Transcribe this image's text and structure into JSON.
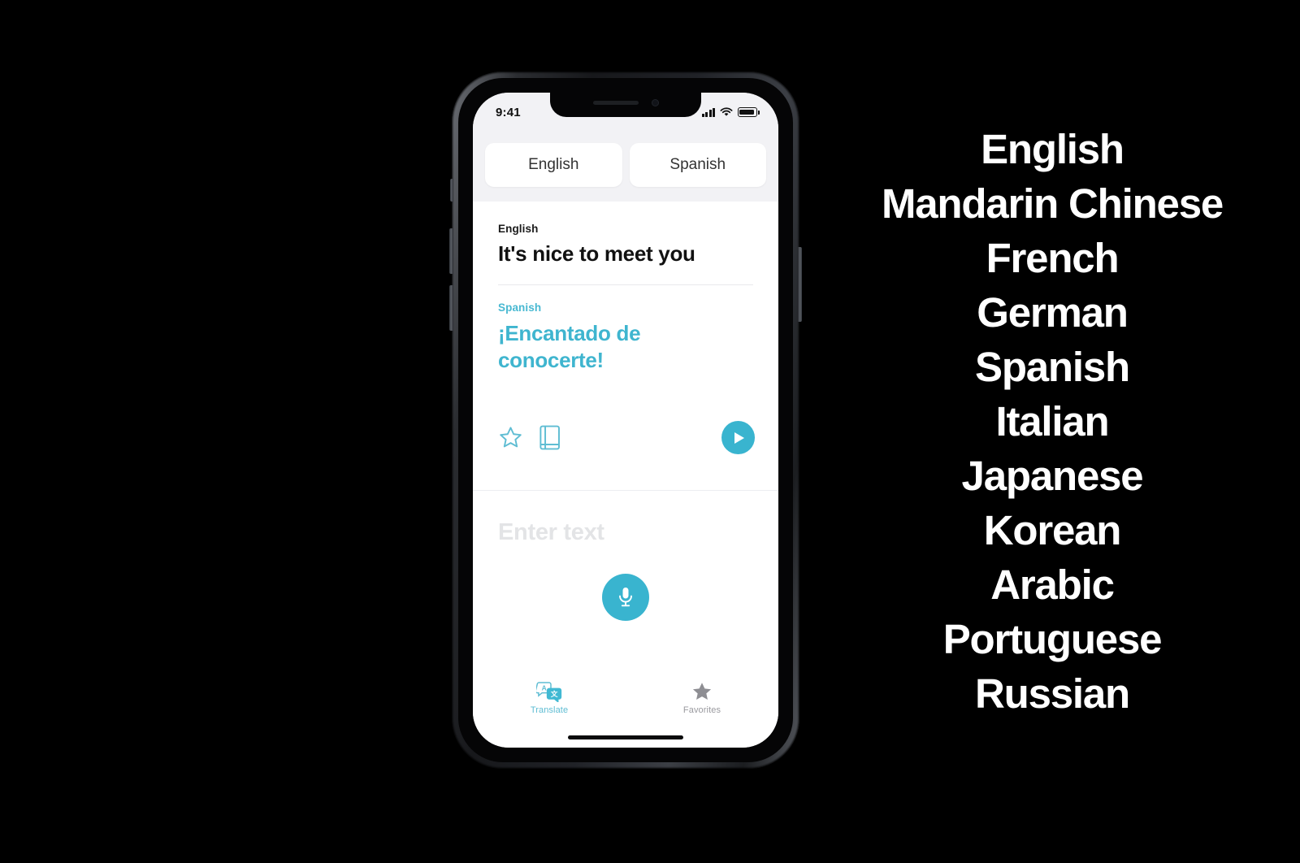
{
  "background_color": "#000000",
  "accent_color": "#39b4cf",
  "phone": {
    "status_bar": {
      "time": "9:41",
      "cellular_icon": "cellular-signal-icon",
      "wifi_icon": "wifi-icon",
      "battery_icon": "battery-icon"
    },
    "language_header": {
      "source_chip_label": "English",
      "target_chip_label": "Spanish"
    },
    "translation_card": {
      "source_language_label": "English",
      "source_text": "It's nice to meet you",
      "target_language_label": "Spanish",
      "target_text": "¡Encantado de conocerte!",
      "actions": {
        "favorite_icon": "star-outline-icon",
        "dictionary_icon": "book-icon",
        "play_icon": "play-icon"
      }
    },
    "input_section": {
      "placeholder": "Enter text",
      "microphone_icon": "microphone-icon"
    },
    "tab_bar": {
      "tabs": [
        {
          "label": "Translate",
          "icon": "translate-bubbles-icon",
          "selected": true
        },
        {
          "label": "Favorites",
          "icon": "star-filled-icon",
          "selected": false
        }
      ]
    }
  },
  "supported_languages": {
    "items": [
      "English",
      "Mandarin Chinese",
      "French",
      "German",
      "Spanish",
      "Italian",
      "Japanese",
      "Korean",
      "Arabic",
      "Portuguese",
      "Russian"
    ]
  }
}
